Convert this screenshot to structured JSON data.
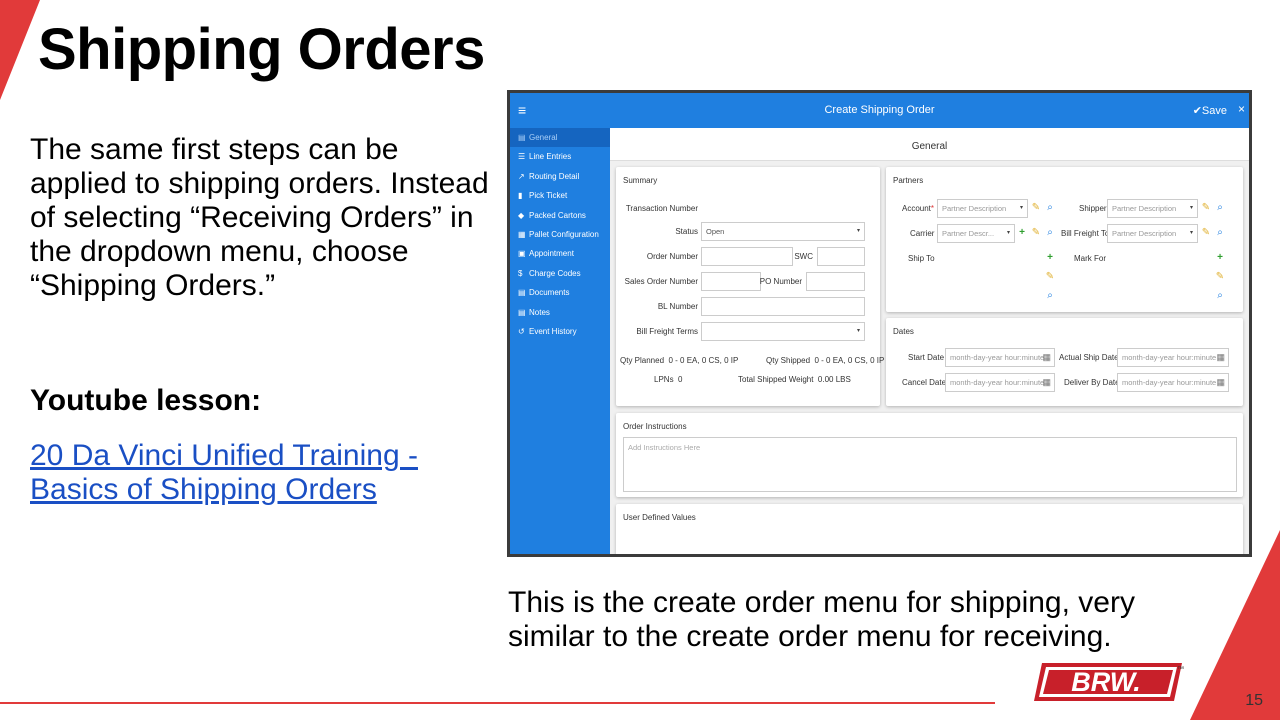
{
  "slide": {
    "title": "Shipping Orders",
    "body": "The same first steps can be applied to shipping orders. Instead of selecting “Receiving Orders” in the dropdown menu, choose “Shipping Orders.”",
    "youtube_heading": "Youtube lesson:",
    "youtube_link": "20 Da Vinci Unified Training - Basics of Shipping Orders",
    "caption": "This is the create order menu for shipping, very similar to the create order menu for receiving.",
    "page_number": "15",
    "logo_text": "BRW.",
    "logo_tm": "™",
    "colors": {
      "accent_red": "#e13a3a",
      "app_blue": "#1f7fe0",
      "link": "#1a4fc4"
    }
  },
  "app": {
    "menu_icon": "≡",
    "title": "Create Shipping Order",
    "save_label": "✔Save",
    "close_label": "×",
    "main_tab": "General",
    "sidebar": [
      {
        "label": "General",
        "icon": "▤"
      },
      {
        "label": "Line Entries",
        "icon": "☰"
      },
      {
        "label": "Routing Detail",
        "icon": "↗"
      },
      {
        "label": "Pick Ticket",
        "icon": "▮"
      },
      {
        "label": "Packed Cartons",
        "icon": "◆"
      },
      {
        "label": "Pallet Configuration",
        "icon": "▦"
      },
      {
        "label": "Appointment",
        "icon": "▣"
      },
      {
        "label": "Charge Codes",
        "icon": "$"
      },
      {
        "label": "Documents",
        "icon": "▤"
      },
      {
        "label": "Notes",
        "icon": "▤"
      },
      {
        "label": "Event History",
        "icon": "↺"
      }
    ],
    "summary": {
      "heading": "Summary",
      "transaction_number_label": "Transaction Number",
      "status_label": "Status",
      "status_value": "Open",
      "order_number_label": "Order Number",
      "swc_label": "SWC",
      "sales_order_label": "Sales Order Number",
      "po_number_label": "PO Number",
      "bl_number_label": "BL Number",
      "bill_freight_terms_label": "Bill Freight Terms",
      "qty_planned_label": "Qty Planned",
      "qty_planned_value": "0 - 0 EA, 0 CS, 0 IP",
      "qty_shipped_label": "Qty Shipped",
      "qty_shipped_value": "0 - 0 EA, 0 CS, 0 IP",
      "lpns_label": "LPNs",
      "lpns_value": "0",
      "shipped_weight_label": "Total Shipped Weight",
      "shipped_weight_value": "0.00 LBS"
    },
    "partners": {
      "heading": "Partners",
      "account_label": "Account",
      "required_mark": "*",
      "shipper_label": "Shipper",
      "carrier_label": "Carrier",
      "bill_freight_to_label": "Bill Freight To",
      "ship_to_label": "Ship To",
      "mark_for_label": "Mark For",
      "placeholder": "Partner Description",
      "placeholder_short": "Partner Descr..."
    },
    "dates": {
      "heading": "Dates",
      "start_label": "Start Date",
      "actual_ship_label": "Actual Ship Date",
      "cancel_label": "Cancel Date",
      "deliver_by_label": "Deliver By Date",
      "placeholder": "month-day-year hour:minute"
    },
    "instructions": {
      "heading": "Order Instructions",
      "placeholder": "Add Instructions Here"
    },
    "udv": {
      "heading": "User Defined Values"
    },
    "icons": {
      "dropdown": "▾",
      "plus": "+",
      "edit": "✎",
      "search": "⌕",
      "calendar": "▦"
    }
  }
}
